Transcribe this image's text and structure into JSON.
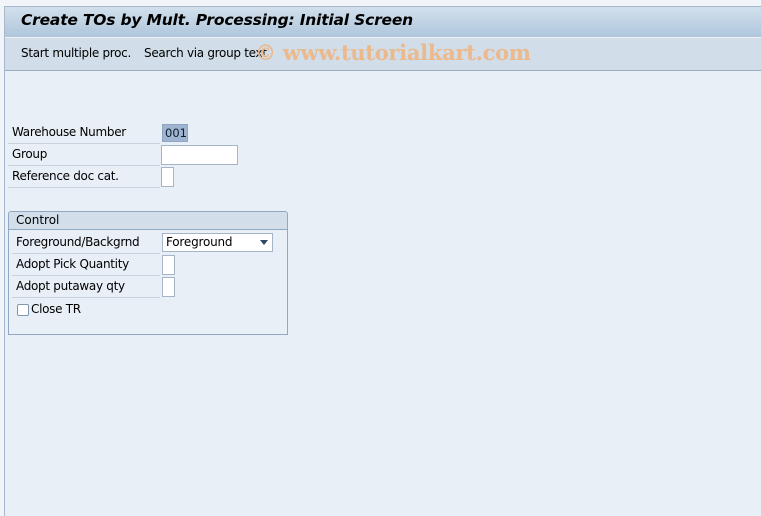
{
  "window": {
    "title": "Create TOs by Mult. Processing: Initial Screen"
  },
  "toolbar": {
    "buttons": [
      {
        "label": "Start multiple proc."
      },
      {
        "label": "Search via group text"
      }
    ],
    "watermark": "© www.tutorialkart.com"
  },
  "form": {
    "warehouse_number": {
      "label": "Warehouse Number",
      "value": "001"
    },
    "group": {
      "label": "Group",
      "value": ""
    },
    "reference_doc_cat": {
      "label": "Reference doc cat.",
      "value": ""
    }
  },
  "control": {
    "title": "Control",
    "foreground_backgrnd": {
      "label": "Foreground/Backgrnd",
      "selected": "Foreground"
    },
    "adopt_pick_quantity": {
      "label": "Adopt Pick Quantity",
      "value": ""
    },
    "adopt_putaway_qty": {
      "label": "Adopt putaway qty",
      "value": ""
    },
    "close_tr": {
      "label": "Close TR",
      "checked": false
    }
  }
}
